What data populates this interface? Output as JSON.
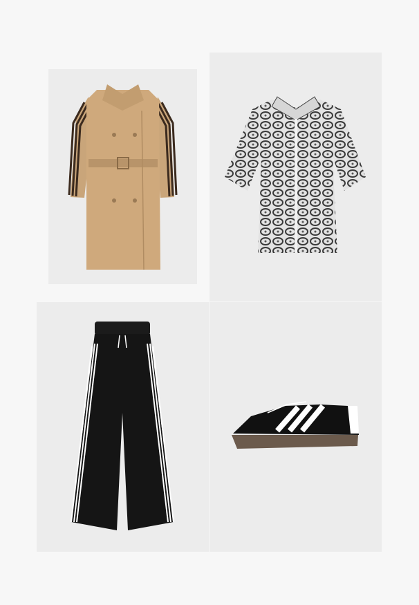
{
  "collage": {
    "items": [
      {
        "name": "trench-coat",
        "color": "#c9a57a",
        "accent": "#3b2a1e"
      },
      {
        "name": "snakeskin-shirt",
        "color": "#d9d9d9",
        "accent": "#3a3a3a"
      },
      {
        "name": "track-pants",
        "color": "#151515",
        "accent": "#ffffff"
      },
      {
        "name": "sneaker",
        "color": "#111111",
        "accent": "#ffffff"
      }
    ]
  }
}
